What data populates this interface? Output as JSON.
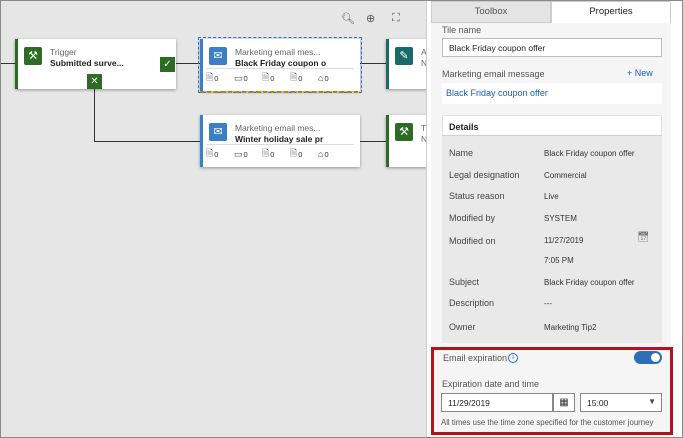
{
  "canvas": {
    "tiles": [
      {
        "subtitle": "Trigger",
        "title": "Submitted surve...",
        "icon": "trigger-icon",
        "color": "#2e6b24"
      },
      {
        "subtitle": "Marketing email mes...",
        "title": "Black Friday coupon o",
        "icon": "email-icon",
        "color": "#3b7fc4",
        "stats": [
          "0",
          "0",
          "0",
          "0",
          "0"
        ]
      },
      {
        "subtitle": "Marketing email mes...",
        "title": "Winter holiday sale pr",
        "icon": "email-icon",
        "color": "#3b7fc4",
        "stats": [
          "0",
          "0",
          "0",
          "0",
          "0"
        ]
      },
      {
        "subtitle": "A",
        "title": "N",
        "icon": "activity-icon",
        "color": "#1a6a6a"
      },
      {
        "subtitle": "T",
        "title": "N",
        "icon": "trigger-icon",
        "color": "#2e6b24"
      }
    ]
  },
  "panel": {
    "tabs": [
      "Toolbox",
      "Properties"
    ],
    "tile_name_label": "Tile name",
    "tile_name_value": "Black Friday coupon offer",
    "message_label": "Marketing email message",
    "new_label": "+ New",
    "message_link": "Black Friday coupon offer",
    "details_title": "Details",
    "details": [
      {
        "key": "Name",
        "value": "Black Friday coupon offer"
      },
      {
        "key": "Legal designation",
        "value": "Commercial"
      },
      {
        "key": "Status reason",
        "value": "Live"
      },
      {
        "key": "Modified by",
        "value": "SYSTEM"
      },
      {
        "key": "Modified on",
        "value": "11/27/2019"
      },
      {
        "key": "",
        "value": "7:05 PM"
      },
      {
        "key": "Subject",
        "value": "Black Friday coupon offer"
      },
      {
        "key": "Description",
        "value": "---"
      },
      {
        "key": "Owner",
        "value": "Marketing Tip2"
      }
    ],
    "email_expiration_label": "Email expiration",
    "email_expiration_on": true,
    "expiration_label": "Expiration date and time",
    "expiration_date": "11/29/2019",
    "expiration_time": "15:00",
    "hint": "All times use the time zone specified for the customer journey"
  },
  "colors": {
    "highlight": "#b5101e",
    "accent": "#2d6fb6"
  }
}
